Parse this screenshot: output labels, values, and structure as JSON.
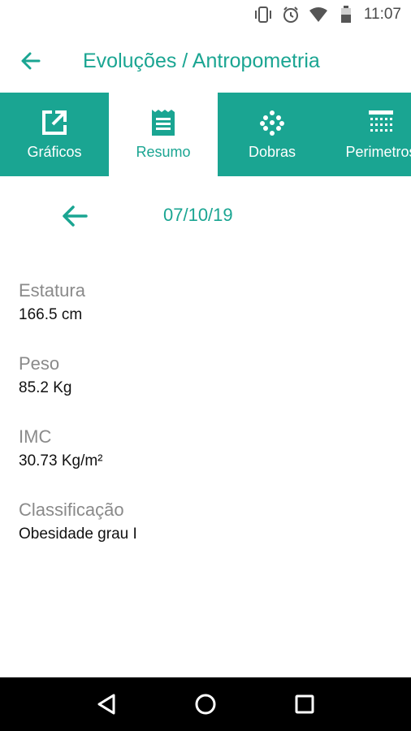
{
  "status_bar": {
    "time": "11:07",
    "icons": [
      "vibrate-icon",
      "alarm-icon",
      "wifi-icon",
      "battery-icon"
    ]
  },
  "app_bar": {
    "title": "Evoluções / Antropometria",
    "back_icon": "arrow-left-icon"
  },
  "tabs": [
    {
      "label": "Gráficos",
      "icon": "open-external-icon",
      "active": false
    },
    {
      "label": "Resumo",
      "icon": "summary-list-icon",
      "active": true
    },
    {
      "label": "Dobras",
      "icon": "dots-icon",
      "active": false
    },
    {
      "label": "Perimetros",
      "icon": "grid-icon",
      "active": false
    }
  ],
  "date_nav": {
    "date": "07/10/19",
    "prev_icon": "arrow-left-icon"
  },
  "summary": [
    {
      "label": "Estatura",
      "value": "166.5 cm"
    },
    {
      "label": "Peso",
      "value": "85.2 Kg"
    },
    {
      "label": "IMC",
      "value": "30.73 Kg/m²"
    },
    {
      "label": "Classificação",
      "value": "Obesidade grau I"
    }
  ],
  "colors": {
    "accent": "#1aa592",
    "label_gray": "#8a8a8a",
    "value_black": "#111111",
    "nav_bg": "#000000"
  }
}
